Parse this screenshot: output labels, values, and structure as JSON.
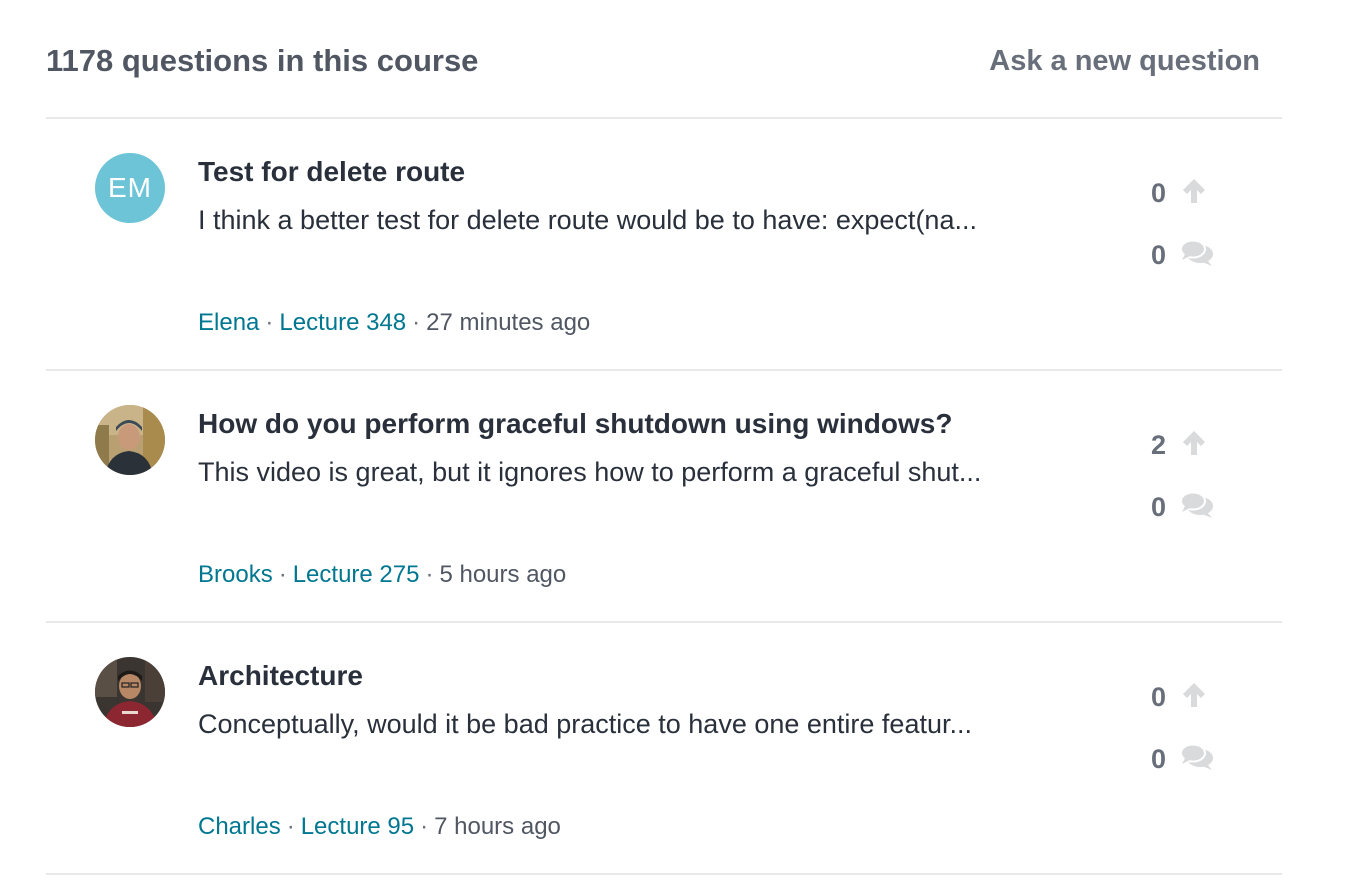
{
  "header": {
    "question_count": "1178 questions in this course",
    "ask_label": "Ask a new question"
  },
  "questions": [
    {
      "avatar_initials": "EM",
      "title": "Test for delete route",
      "body": "I think a better test for delete route would be to have: expect(na...",
      "author": "Elena",
      "lecture": "Lecture 348",
      "time": "27 minutes ago",
      "upvotes": "0",
      "replies": "0"
    },
    {
      "avatar_initials": "",
      "title": "How do you perform graceful shutdown using windows?",
      "body": "This video is great, but it ignores how to perform a graceful shut...",
      "author": "Brooks",
      "lecture": "Lecture 275",
      "time": "5 hours ago",
      "upvotes": "2",
      "replies": "0"
    },
    {
      "avatar_initials": "",
      "title": "Architecture",
      "body": "Conceptually, would it be bad practice to have one entire featur...",
      "author": "Charles",
      "lecture": "Lecture 95",
      "time": "7 hours ago",
      "upvotes": "0",
      "replies": "0"
    }
  ],
  "meta_separator": "·",
  "icons": {
    "upvote": "arrow-up-icon",
    "replies": "speech-bubbles-icon"
  },
  "colors": {
    "link": "#007791",
    "avatar_bg": "#6cc4d6",
    "text": "#29303b",
    "muted": "#686f7a",
    "icon": "#d9dadc"
  }
}
